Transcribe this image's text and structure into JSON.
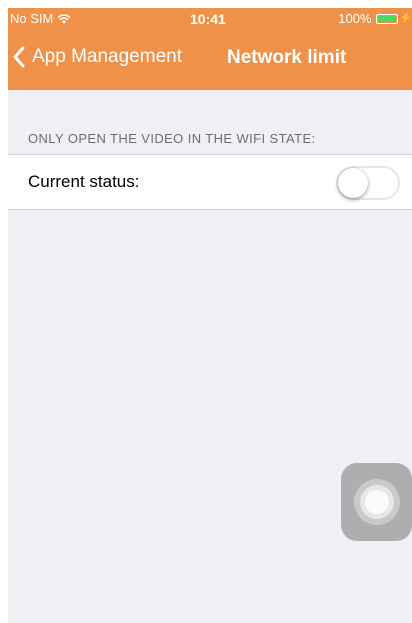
{
  "status_bar": {
    "carrier": "No SIM",
    "time": "10:41",
    "battery": "100%",
    "battery_level": 1.0,
    "icons": [
      "wifi-icon",
      "battery-icon",
      "charging-icon"
    ]
  },
  "nav_bar": {
    "back_label": "App Management",
    "title": "Network limit",
    "background": "#f0914a"
  },
  "section": {
    "header": "ONLY OPEN THE VIDEO IN THE WIFI STATE:",
    "row_label": "Current status:",
    "toggle_on": false
  },
  "assistive_touch": {
    "icon": "assistive-touch-icon"
  }
}
